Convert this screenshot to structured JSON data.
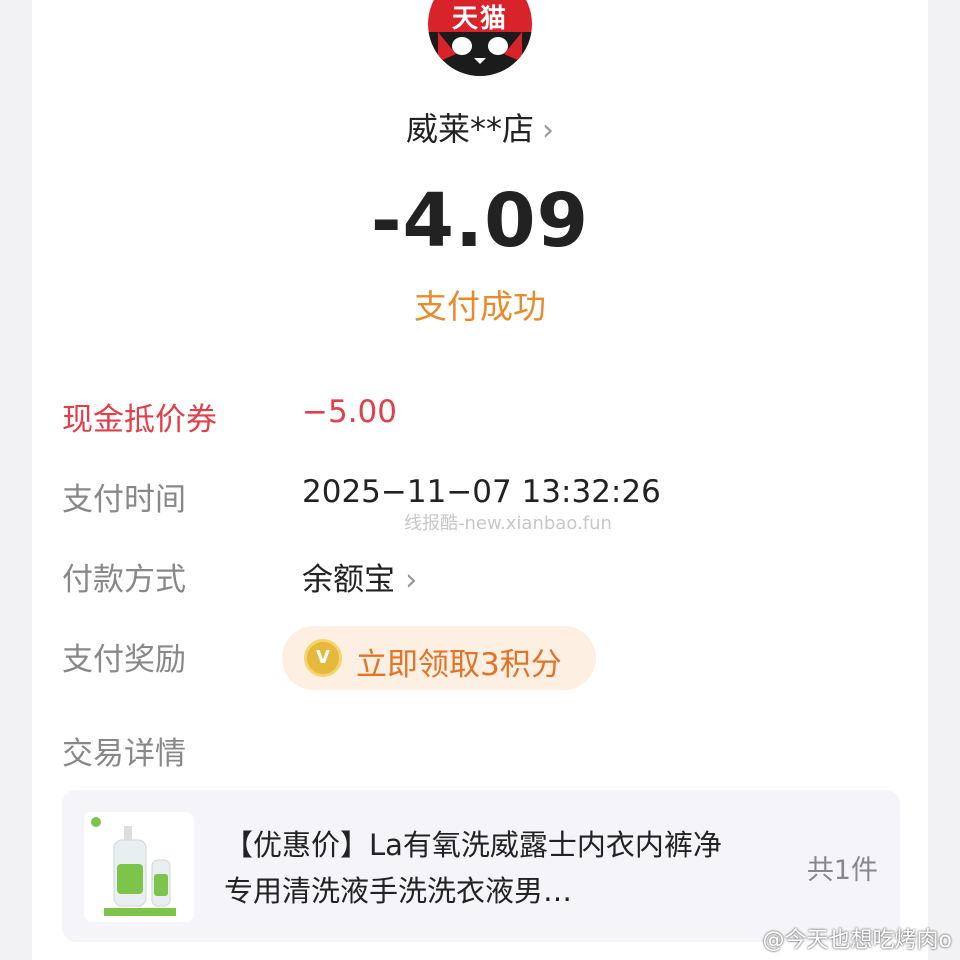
{
  "store": {
    "logo_text": "天猫",
    "name": "威莱**店",
    "chevron": "›"
  },
  "payment": {
    "amount": "-4.09",
    "status": "支付成功"
  },
  "details": {
    "coupon_label": "现金抵价券",
    "coupon_value": "−5.00",
    "time_label": "支付时间",
    "time_value": "2025−11−07 13:32:26",
    "method_label": "付款方式",
    "method_value": "余额宝",
    "reward_label": "支付奖励",
    "reward_button": "立即领取3积分",
    "reward_icon": "V",
    "trade_label": "交易详情"
  },
  "order_item": {
    "title": "【优惠价】La有氧洗威露士内衣内裤净专用清洗液手洗洗衣液男…",
    "count": "共1件"
  },
  "overlays": {
    "watermark": "线报酷-new.xianbao.fun",
    "weibo_handle": "@今天也想吃烤肉o"
  },
  "colors": {
    "brand_red": "#d8232a",
    "status_orange": "#e98a2c",
    "coupon_red": "#e0404a",
    "reward_bg": "#fdefe1"
  }
}
